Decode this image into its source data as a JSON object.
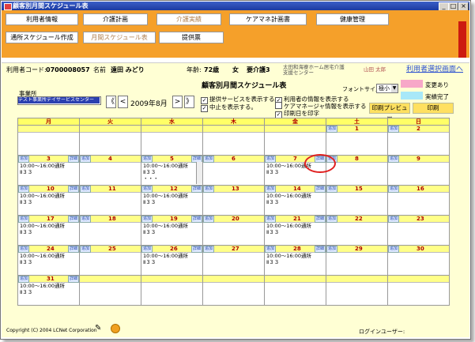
{
  "window": {
    "title": "顧客別月間スケジュール表"
  },
  "nav_row1": [
    "利用者情報",
    "介護計画",
    "介護実績",
    "ケアマネ計画書",
    "健康管理"
  ],
  "nav_row1_active": 2,
  "nav_row2": [
    "通所スケジュール作成",
    "月間スケジュール表",
    "提供票"
  ],
  "nav_row2_active": 1,
  "info": {
    "code_label": "利用者コード:",
    "code_value": "0700008057",
    "name_label": "名前",
    "name_value": "遠田 みどり",
    "age_label": "年齢:",
    "age_value": "72歳",
    "gender": "女",
    "care_level": "要介護3",
    "center_line1": "太田和海寮ホーム居宅介護",
    "center_line2": "支援センター",
    "staff": "山田 太郎",
    "select_link": "利用者選択画面へ"
  },
  "main": {
    "sched_title": "顧客別月間スケジュール表",
    "office_label": "事業所",
    "office_value": "テスト事業所デイサービスセンター",
    "year": "2009年",
    "month": "8月",
    "prev2": "《",
    "prev1": "<",
    "next1": ">",
    "next2": "》",
    "opt1": "提供サービスを表示する。",
    "opt2": "中止を表示する。",
    "opt3": "利用者の情報を表示する",
    "opt4": "ケアマネージャ情報を表示する",
    "opt5": "印刷日を印字",
    "opt_checked": [
      true,
      true,
      true,
      false,
      true
    ],
    "font_label": "フォントサイズ",
    "font_value": "極小",
    "legend_changed": "変更あり",
    "legend_done": "実績完了",
    "preview_btn": "印刷プレビュー",
    "print_btn": "印刷"
  },
  "calendar": {
    "weekdays": [
      "月",
      "火",
      "水",
      "木",
      "金",
      "土",
      "日"
    ],
    "add_label": "追加",
    "detail_label": "詳細",
    "weeks": [
      [
        {
          "d": ""
        },
        {
          "d": ""
        },
        {
          "d": ""
        },
        {
          "d": ""
        },
        {
          "d": ""
        },
        {
          "d": "1"
        },
        {
          "d": "2"
        }
      ],
      [
        {
          "d": "3",
          "t": [
            "10:00～16:00通所",
            "Ⅱ３３"
          ]
        },
        {
          "d": "4"
        },
        {
          "d": "5",
          "t": [
            "10:00～16:00通所",
            "Ⅱ３３",
            "・・・"
          ]
        },
        {
          "d": "6"
        },
        {
          "d": "7",
          "t": [
            "10:00～16:00通所",
            "Ⅱ３３"
          ]
        },
        {
          "d": "8"
        },
        {
          "d": "9"
        }
      ],
      [
        {
          "d": "10",
          "t": [
            "10:00～16:00通所",
            "Ⅱ３３"
          ]
        },
        {
          "d": "11"
        },
        {
          "d": "12",
          "t": [
            "10:00～16:00通所",
            "Ⅱ３３"
          ]
        },
        {
          "d": "13"
        },
        {
          "d": "14",
          "t": [
            "10:00～16:00通所",
            "Ⅱ３３"
          ]
        },
        {
          "d": "15"
        },
        {
          "d": "16"
        }
      ],
      [
        {
          "d": "17",
          "t": [
            "10:00～16:00通所",
            "Ⅱ３３"
          ]
        },
        {
          "d": "18"
        },
        {
          "d": "19",
          "t": [
            "10:00～16:00通所",
            "Ⅱ３３"
          ]
        },
        {
          "d": "20"
        },
        {
          "d": "21",
          "t": [
            "10:00～16:00通所",
            "Ⅱ３３"
          ]
        },
        {
          "d": "22"
        },
        {
          "d": "23"
        }
      ],
      [
        {
          "d": "24",
          "t": [
            "10:00～16:00通所",
            "Ⅱ３３"
          ]
        },
        {
          "d": "25"
        },
        {
          "d": "26",
          "t": [
            "10:00～16:00通所",
            "Ⅱ３３"
          ]
        },
        {
          "d": "27"
        },
        {
          "d": "28",
          "t": [
            "10:00～16:00通所",
            "Ⅱ３３"
          ]
        },
        {
          "d": "29"
        },
        {
          "d": "30"
        }
      ],
      [
        {
          "d": "31",
          "t": [
            "10:00～16:00通所",
            "Ⅱ３３"
          ]
        },
        {
          "d": ""
        },
        {
          "d": ""
        },
        {
          "d": ""
        },
        {
          "d": ""
        },
        {
          "d": ""
        },
        {
          "d": ""
        }
      ]
    ]
  },
  "footer": {
    "copyright": "Copyright (C) 2004 LCNet Corporation",
    "login_label": "ログインユーザー:"
  },
  "colors": {
    "orange": "#f5a02a",
    "cream": "#ffffd4",
    "header_yellow": "#ffff66",
    "legend_pink": "#f7a8c8",
    "legend_cyan": "#a8e8f8",
    "highlight_red": "#e02020"
  }
}
